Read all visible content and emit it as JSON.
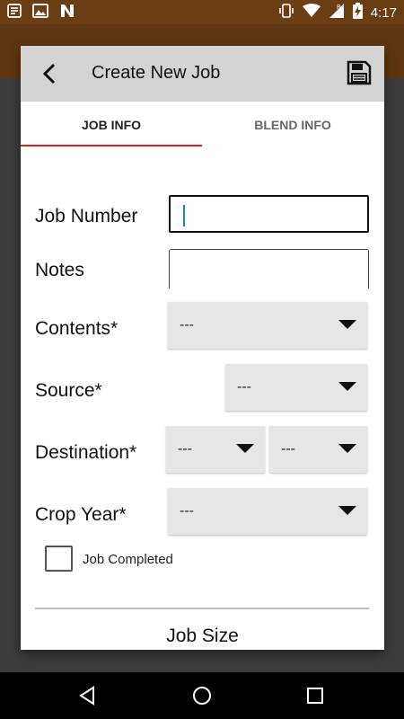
{
  "status_bar": {
    "time": "4:17",
    "left_icons": [
      "notification-list-icon",
      "image-icon",
      "n-app-icon"
    ],
    "right_icons": [
      "vibrate-icon",
      "wifi-icon",
      "roaming-signal-icon",
      "battery-charging-icon"
    ]
  },
  "dialog": {
    "title": "Create New Job",
    "tabs": [
      {
        "label": "JOB INFO",
        "active": true
      },
      {
        "label": "BLEND INFO",
        "active": false
      }
    ],
    "fields": {
      "job_number": {
        "label": "Job Number",
        "value": ""
      },
      "notes": {
        "label": "Notes",
        "value": ""
      },
      "contents": {
        "label": "Contents*",
        "value": "---"
      },
      "source": {
        "label": "Source*",
        "value": "---"
      },
      "destination": {
        "label": "Destination*",
        "value_1": "---",
        "value_2": "---"
      },
      "crop_year": {
        "label": "Crop Year*",
        "value": "---"
      }
    },
    "job_completed": {
      "label": "Job Completed",
      "checked": false
    },
    "section_title": "Job Size"
  },
  "colors": {
    "accent": "#c8282b",
    "header_bg": "#d3d3d3",
    "cursor": "#1e8c8c"
  }
}
